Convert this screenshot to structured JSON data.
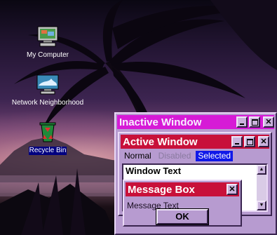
{
  "desktop": {
    "icons": [
      {
        "label": "My Computer",
        "icon": "computer-icon"
      },
      {
        "label": "Network Neighborhood",
        "icon": "network-icon"
      },
      {
        "label": "Recycle Bin",
        "icon": "recycle-bin-icon"
      }
    ]
  },
  "inactive_window": {
    "title": "Inactive Window",
    "title_color": "#d61ad6"
  },
  "active_window": {
    "title": "Active Window",
    "title_color": "#c8103a",
    "menu": {
      "normal": "Normal",
      "disabled": "Disabled",
      "selected": "Selected"
    },
    "body_text": "Window Text"
  },
  "message_box": {
    "title": "Message Box",
    "text": "Message Text",
    "ok_label": "OK",
    "close_glyph": "✕"
  },
  "window_buttons": {
    "close_glyph": "✕"
  },
  "scroll_glyphs": {
    "up": "▲",
    "down": "▼"
  }
}
